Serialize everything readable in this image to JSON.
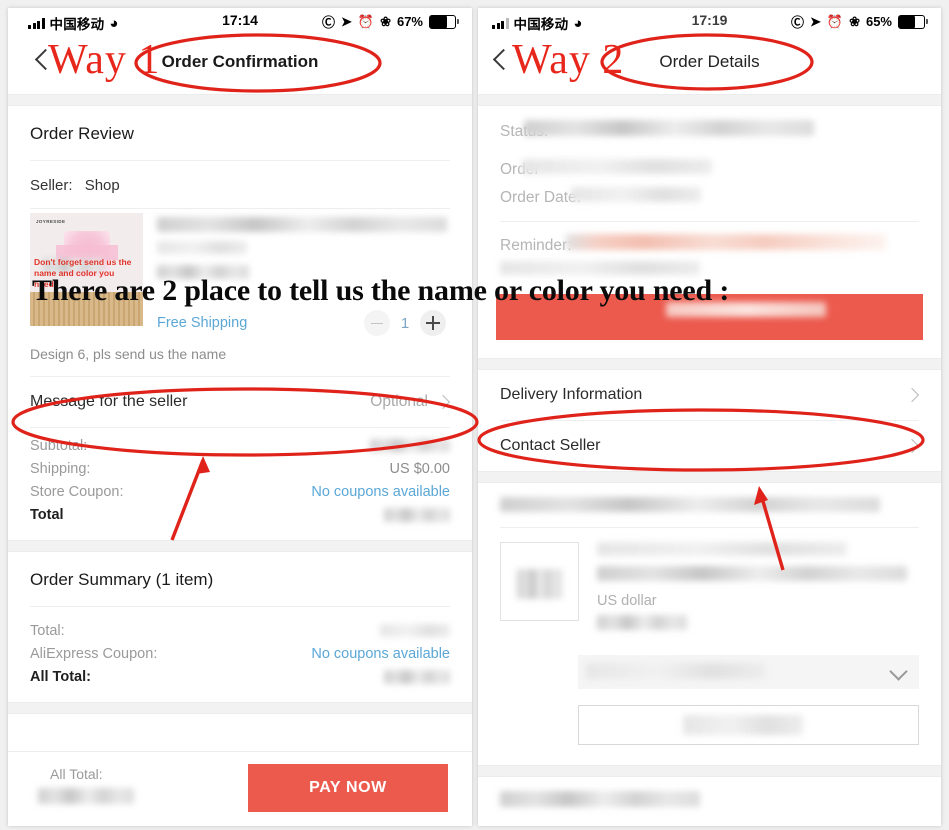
{
  "annotations": {
    "way1_label": "Way 1",
    "way2_label": "Way 2",
    "overlay_sentence": "There are 2 place to tell us the name or color you need :",
    "circle_color": "#e0231a",
    "arrow_color": "#e0231a"
  },
  "left_phone": {
    "status_bar": {
      "carrier": "中国移动",
      "time": "17:14",
      "battery_percent": "67%",
      "icons": [
        "signal-bars-icon",
        "wifi-icon",
        "rotation-lock-icon",
        "location-arrow-icon",
        "alarm-clock-icon",
        "bluetooth-icon",
        "battery-icon"
      ]
    },
    "nav": {
      "title": "Order Confirmation",
      "back_icon": "back-chevron-icon"
    },
    "order_review_title": "Order Review",
    "seller_label": "Seller:",
    "seller_name": "Shop",
    "product": {
      "image_brand": "JOYRESIDE",
      "image_caption": "Don't forget send us the name and color you need!",
      "shipping_label": "Free Shipping",
      "quantity": "1",
      "minus_label": "−",
      "plus_label": "+",
      "variant": "Design 6, pls send us the name"
    },
    "message_row": {
      "label": "Message for the seller",
      "value": "Optional"
    },
    "price_lines": [
      {
        "label": "Subtotal:",
        "value": "",
        "blurred": true
      },
      {
        "label": "Shipping:",
        "value": "US $0.00",
        "blurred": false
      },
      {
        "label": "Store Coupon:",
        "value": "No coupons available",
        "link": true
      },
      {
        "label": "Total",
        "value": "",
        "blurred": true,
        "bold": true
      }
    ],
    "order_summary_title": "Order Summary (1 item)",
    "summary_lines": [
      {
        "label": "Total:",
        "value": "",
        "blurred": true
      },
      {
        "label": "AliExpress Coupon:",
        "value": "No coupons available",
        "link": true
      },
      {
        "label": "All Total:",
        "value": "",
        "blurred": true,
        "bold": true
      }
    ],
    "pay_bar": {
      "total_label": "All Total:",
      "button_label": "PAY NOW",
      "button_color": "#ec5a4e"
    }
  },
  "right_phone": {
    "status_bar": {
      "carrier": "中国移动",
      "time": "17:19",
      "battery_percent": "65%",
      "icons": [
        "signal-bars-icon",
        "wifi-icon",
        "rotation-lock-icon",
        "location-arrow-icon",
        "alarm-clock-icon",
        "bluetooth-icon",
        "battery-icon"
      ]
    },
    "nav": {
      "title": "Order Details",
      "back_icon": "back-chevron-icon"
    },
    "detail_lines": [
      {
        "label": "Status:"
      },
      {
        "label": "Order"
      },
      {
        "label": "Order Date:"
      },
      {
        "label": "Reminder:"
      }
    ],
    "red_banner_color": "#ec5a4e",
    "rows": [
      {
        "label": "Delivery Information"
      },
      {
        "label": "Contact Seller"
      }
    ],
    "currency_text": "US dollar"
  }
}
